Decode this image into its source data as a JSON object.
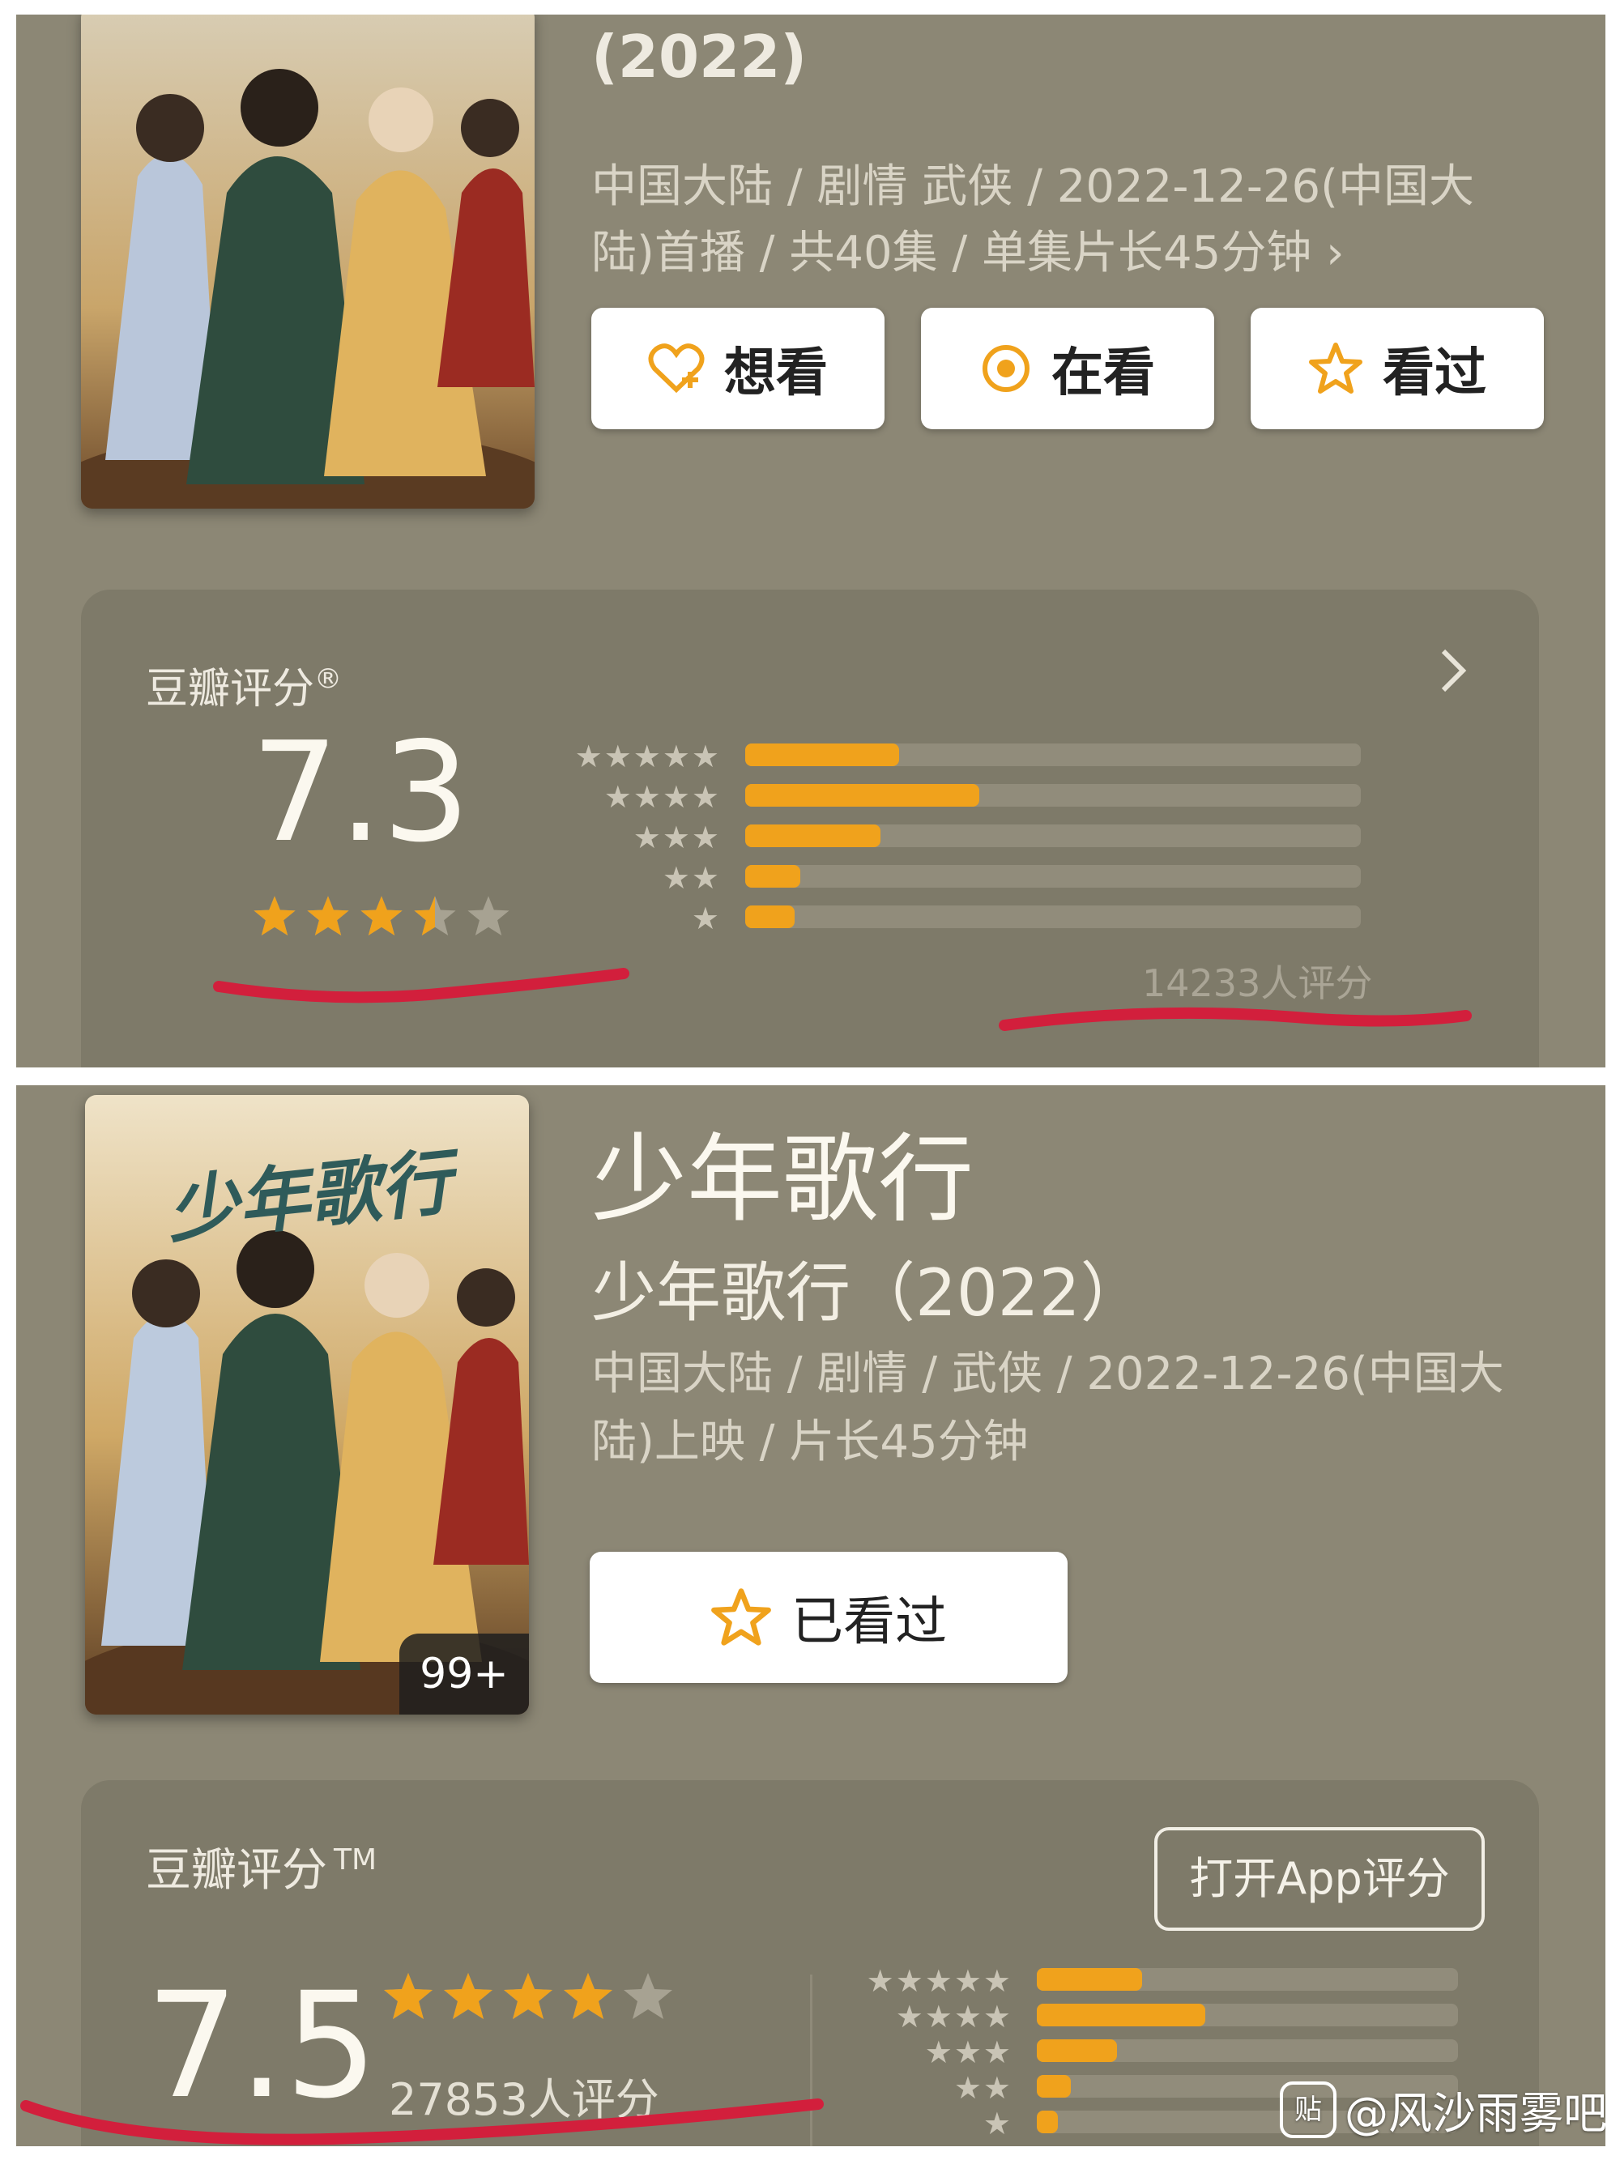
{
  "colors": {
    "panel_bg": "#8c8775",
    "card_bg": "#7e7a69",
    "accent_orange": "#f0a21c",
    "track": "#918c7b",
    "underline_red": "#d21f3c"
  },
  "top": {
    "year": "(2022)",
    "meta": [
      "中国大陆 / 剧情 武侠 / 2022-12-26(中国大",
      "陆)首播 / 共40集 / 单集片长45分钟 ›"
    ],
    "buttons": [
      {
        "label": "想看",
        "icon": "heart-plus-icon"
      },
      {
        "label": "在看",
        "icon": "target-icon"
      },
      {
        "label": "看过",
        "icon": "star-outline-icon"
      }
    ],
    "rating": {
      "title": "豆瓣评分",
      "mark": "®",
      "score": "7.3",
      "stars_filled": 3.5,
      "count": "14233人评分",
      "distribution": [
        0.25,
        0.38,
        0.22,
        0.09,
        0.08
      ],
      "star_labels": [
        "★★★★★",
        "★★★★",
        "★★★",
        "★★",
        "★"
      ]
    }
  },
  "bottom": {
    "title": "少年歌行",
    "subtitle": "少年歌行（2022）",
    "poster_calligraphy": "少年歌行",
    "poster_badge": "99+",
    "meta": [
      "中国大陆 / 剧情 / 武侠 / 2022-12-26(中国大",
      "陆)上映 / 片长45分钟"
    ],
    "watched_button": "已看过",
    "rating": {
      "title": "豆瓣评分",
      "mark": "TM",
      "open_app": "打开App评分",
      "score": "7.5",
      "stars_filled": 4,
      "count": "27853人评分",
      "distribution": [
        0.25,
        0.4,
        0.19,
        0.08,
        0.05
      ],
      "star_labels": [
        "★★★★★",
        "★★★★",
        "★★★",
        "★★",
        "★"
      ]
    }
  },
  "watermark": "@风沙雨雾吧",
  "watermark_icon": "贴"
}
